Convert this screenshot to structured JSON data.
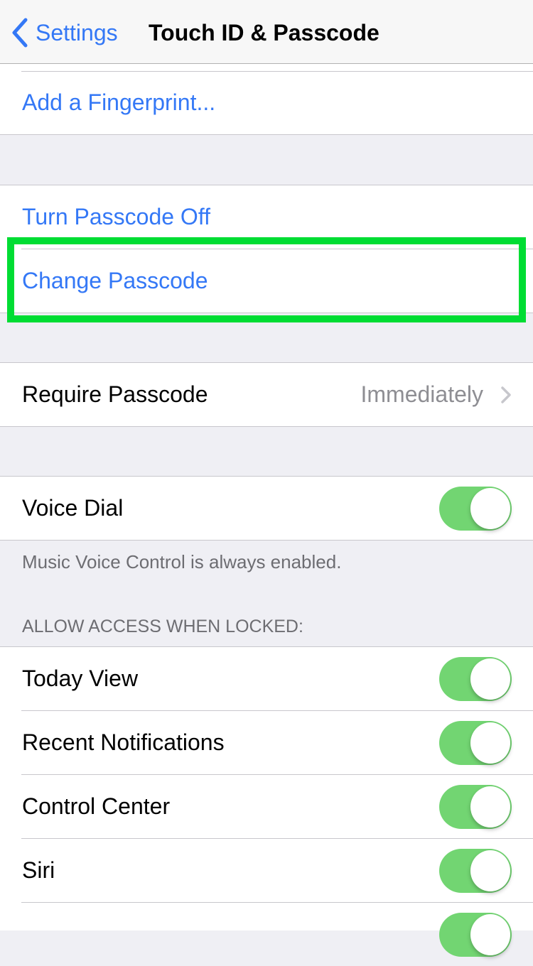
{
  "navbar": {
    "back_label": "Settings",
    "title": "Touch ID & Passcode"
  },
  "fingerprint_group": {
    "add_label": "Add a Fingerprint..."
  },
  "passcode_group": {
    "turn_off_label": "Turn Passcode Off",
    "change_label": "Change Passcode"
  },
  "require_group": {
    "label": "Require Passcode",
    "value": "Immediately"
  },
  "voice_group": {
    "label": "Voice Dial",
    "on": true,
    "footer": "Music Voice Control is always enabled."
  },
  "locked_access": {
    "header": "ALLOW ACCESS WHEN LOCKED:",
    "items": [
      {
        "label": "Today View",
        "on": true
      },
      {
        "label": "Recent Notifications",
        "on": true
      },
      {
        "label": "Control Center",
        "on": true
      },
      {
        "label": "Siri",
        "on": true
      },
      {
        "label": "",
        "on": true
      }
    ]
  },
  "colors": {
    "accent": "#3478f6",
    "toggle_on": "#72d572",
    "highlight": "#00dd33"
  }
}
